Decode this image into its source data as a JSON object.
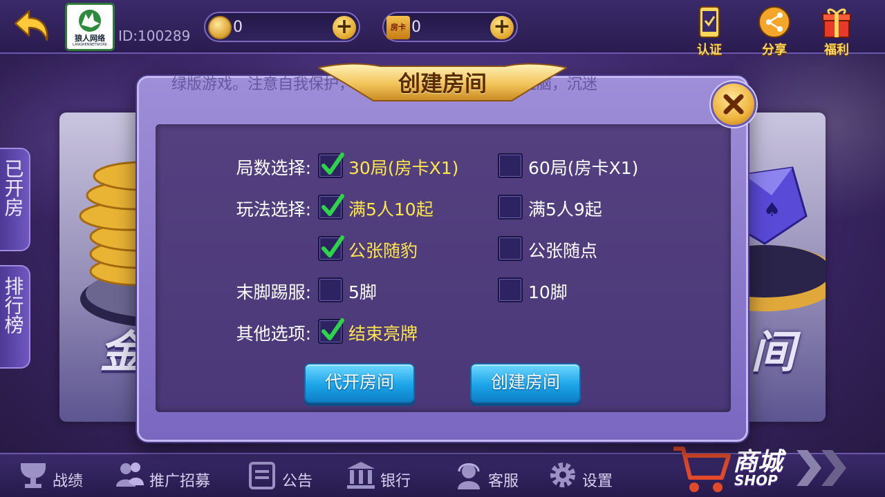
{
  "header": {
    "logo_text": "狼人网络",
    "logo_sub": "LANGRENNETWORK",
    "user_id": "ID:100289",
    "coins": "0",
    "room_cards": "0",
    "room_card_icon": "房卡",
    "icons": [
      {
        "name": "verify-icon",
        "label": "认证"
      },
      {
        "name": "share-icon",
        "label": "分享"
      },
      {
        "name": "gift-icon",
        "label": "福利"
      }
    ]
  },
  "side_tabs": {
    "opened_rooms": "已开房",
    "leaderboard": "排行榜"
  },
  "background_cards": {
    "left_title": "金",
    "right_title": "间"
  },
  "marquee": "绿版游戏。注意自我保护，谨防受骗上当。适度游戏益脑，沉迷",
  "dialog": {
    "title": "创建房间",
    "rows": [
      {
        "label": "局数选择:",
        "options": [
          {
            "text": "30局(房卡X1)",
            "checked": true
          },
          {
            "text": "60局(房卡X1)",
            "checked": false
          }
        ]
      },
      {
        "label": "玩法选择:",
        "options": [
          {
            "text": "满5人10起",
            "checked": true
          },
          {
            "text": "满5人9起",
            "checked": false
          }
        ]
      },
      {
        "label": "",
        "options": [
          {
            "text": "公张随豹",
            "checked": true
          },
          {
            "text": "公张随点",
            "checked": false
          }
        ]
      },
      {
        "label": "末脚踢服:",
        "options": [
          {
            "text": "5脚",
            "checked": false
          },
          {
            "text": "10脚",
            "checked": false
          }
        ]
      },
      {
        "label": "其他选项:",
        "options": [
          {
            "text": "结束亮牌",
            "checked": true
          }
        ]
      }
    ],
    "buttons": {
      "proxy_open": "代开房间",
      "create": "创建房间"
    }
  },
  "bottom_nav": [
    {
      "name": "records",
      "label": "战绩",
      "icon": "trophy-icon"
    },
    {
      "name": "promote",
      "label": "推广招募",
      "icon": "people-icon"
    },
    {
      "name": "notice",
      "label": "公告",
      "icon": "notice-icon"
    },
    {
      "name": "bank",
      "label": "银行",
      "icon": "bank-icon"
    },
    {
      "name": "service",
      "label": "客服",
      "icon": "headset-icon"
    },
    {
      "name": "settings",
      "label": "设置",
      "icon": "gear-icon"
    }
  ],
  "shop": {
    "cn": "商城",
    "en": "SHOP"
  },
  "colors": {
    "checked_text": "#ffe74a",
    "unchecked_text": "#ffffff",
    "check_mark": "#2fd24a",
    "button_blue": "#1ca4e8",
    "gold": "#eeb33d"
  }
}
